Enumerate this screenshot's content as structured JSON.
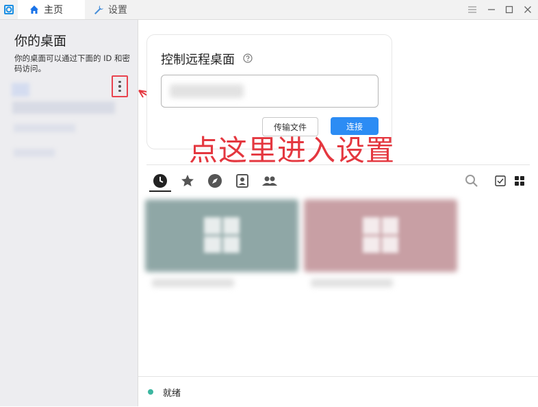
{
  "titlebar": {
    "tabs": [
      {
        "label": "主页",
        "icon": "home-icon"
      },
      {
        "label": "设置",
        "icon": "wrench-icon"
      }
    ]
  },
  "sidebar": {
    "title": "你的桌面",
    "description": "你的桌面可以通过下面的 ID 和密码访问。"
  },
  "connect_card": {
    "title": "控制远程桌面",
    "transfer_label": "传输文件",
    "connect_label": "连接"
  },
  "annotation": {
    "text": "点这里进入设置",
    "color": "#e4373f"
  },
  "peer_tabs": [
    "recent-icon",
    "star-icon",
    "compass-icon",
    "address-book-icon",
    "group-icon"
  ],
  "status": {
    "text": "就绪",
    "color": "#3cb6a0"
  },
  "colors": {
    "accent": "#2c8cf4",
    "sidebar_bg": "#ededf0"
  }
}
